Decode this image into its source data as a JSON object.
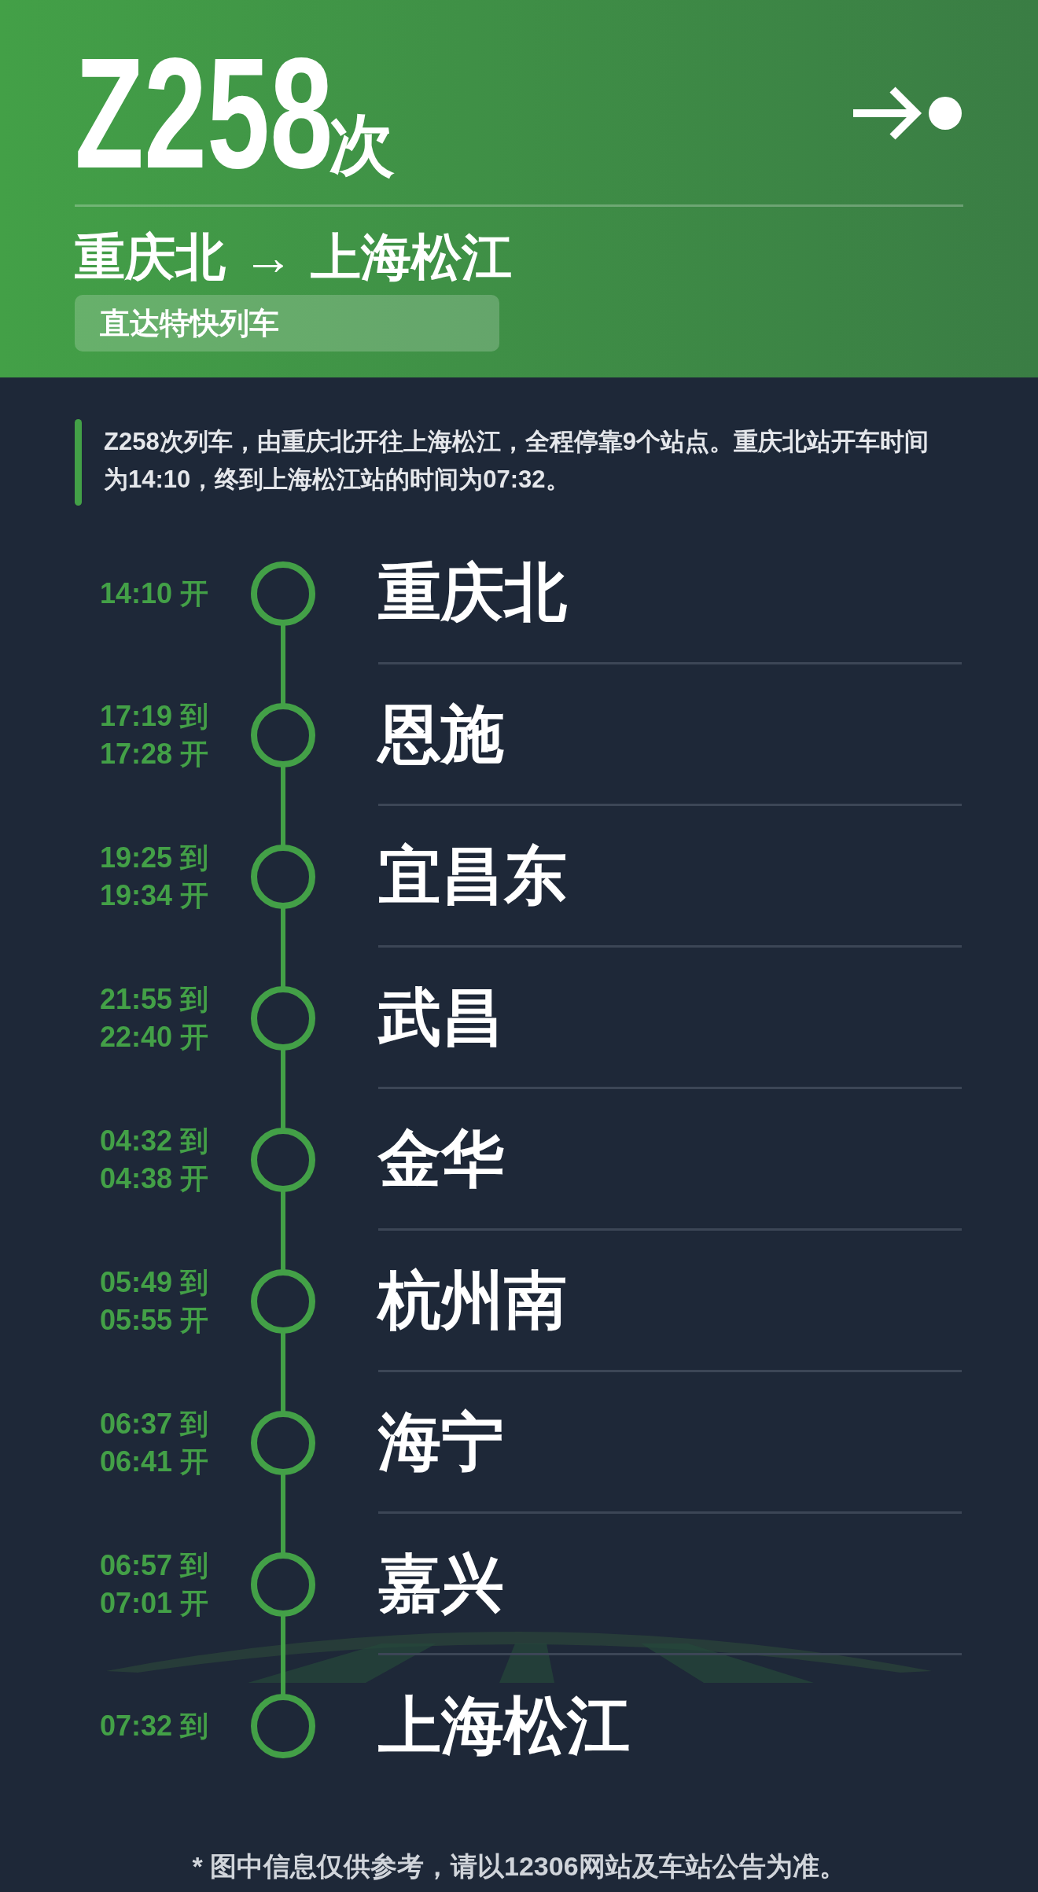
{
  "header": {
    "train_number": "Z258",
    "suffix": "次",
    "route": {
      "from": "重庆北",
      "arrow": "→",
      "to": "上海松江"
    },
    "badge": "直达特快列车"
  },
  "description": "Z258次列车，由重庆北开往上海松江，全程停靠9个站点。重庆北站开车时间为14:10，终到上海松江站的时间为07:32。",
  "stops": [
    {
      "times": [
        "14:10 开"
      ],
      "station": "重庆北"
    },
    {
      "times": [
        "17:19 到",
        "17:28 开"
      ],
      "station": "恩施"
    },
    {
      "times": [
        "19:25 到",
        "19:34 开"
      ],
      "station": "宜昌东"
    },
    {
      "times": [
        "21:55 到",
        "22:40 开"
      ],
      "station": "武昌"
    },
    {
      "times": [
        "04:32 到",
        "04:38 开"
      ],
      "station": "金华"
    },
    {
      "times": [
        "05:49 到",
        "05:55 开"
      ],
      "station": "杭州南"
    },
    {
      "times": [
        "06:37 到",
        "06:41 开"
      ],
      "station": "海宁"
    },
    {
      "times": [
        "06:57 到",
        "07:01 开"
      ],
      "station": "嘉兴"
    },
    {
      "times": [
        "07:32 到"
      ],
      "station": "上海松江"
    }
  ],
  "footnote": "* 图中信息仅供参考，请以12306网站及车站公告为准。"
}
